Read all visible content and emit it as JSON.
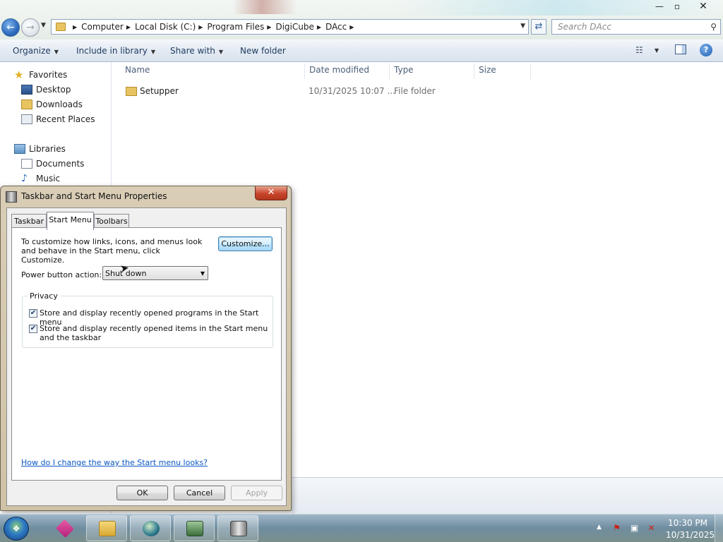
{
  "explorer": {
    "window_controls": {
      "minimize": "—",
      "maximize": "▫",
      "close": "✕"
    },
    "breadcrumb": [
      "Computer",
      "Local Disk (C:)",
      "Program Files",
      "DigiCube",
      "DAcc"
    ],
    "search_placeholder": "Search DAcc",
    "toolbar": {
      "organize": "Organize",
      "include_in_library": "Include in library",
      "share_with": "Share with",
      "new_folder": "New folder"
    },
    "nav": {
      "favorites": "Favorites",
      "desktop": "Desktop",
      "downloads": "Downloads",
      "recent_places": "Recent Places",
      "libraries": "Libraries",
      "documents": "Documents",
      "music": "Music"
    },
    "columns": {
      "name": "Name",
      "date_modified": "Date modified",
      "type": "Type",
      "size": "Size"
    },
    "files": [
      {
        "name": "Setupper",
        "date": "10/31/2025 10:07 ...",
        "type": "File folder",
        "size": ""
      }
    ]
  },
  "dialog": {
    "title": "Taskbar and Start Menu Properties",
    "close": "✕",
    "tabs": [
      "Taskbar",
      "Start Menu",
      "Toolbars"
    ],
    "selected_tab": "Start Menu",
    "intro": "To customize how links, icons, and menus look and behave in the Start menu, click Customize.",
    "customize_button": "Customize...",
    "power_button_label": "Power button action:",
    "power_button_value": "Shut down",
    "privacy": {
      "legend": "Privacy",
      "option1": {
        "label": "Store and display recently opened programs in the Start menu",
        "checked": true
      },
      "option2": {
        "label": "Store and display recently opened items in the Start menu and the taskbar",
        "checked": true
      }
    },
    "help_link": "How do I change the way the Start menu looks?",
    "buttons": {
      "ok": "OK",
      "cancel": "Cancel",
      "apply": "Apply"
    }
  },
  "taskbar": {
    "time": "10:30 PM",
    "date": "10/31/2025",
    "start_icon": "windows-start-orb",
    "pinned": [
      "cube-app-icon",
      "folder-icon",
      "globe-icon",
      "app-window-icon",
      "server-icon"
    ]
  }
}
